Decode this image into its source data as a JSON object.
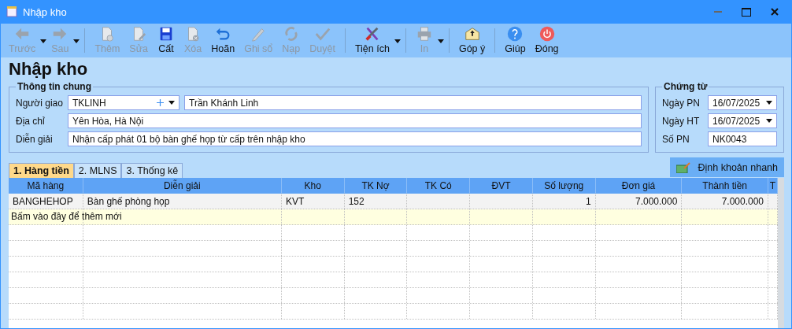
{
  "window": {
    "title": "Nhập kho"
  },
  "toolbar": {
    "groups": [
      [
        {
          "label": "Trước",
          "kind": "left",
          "enabled": false,
          "dropdown": true
        },
        {
          "label": "Sau",
          "kind": "right",
          "enabled": false,
          "dropdown": true
        }
      ],
      [
        {
          "label": "Thêm",
          "kind": "add",
          "enabled": false,
          "dropdown": false
        },
        {
          "label": "Sửa",
          "kind": "edit",
          "enabled": false,
          "dropdown": false
        },
        {
          "label": "Cất",
          "kind": "save",
          "enabled": true,
          "dropdown": false
        },
        {
          "label": "Xóa",
          "kind": "delete",
          "enabled": false,
          "dropdown": false
        },
        {
          "label": "Hoãn",
          "kind": "undo",
          "enabled": true,
          "dropdown": false
        },
        {
          "label": "Ghi sổ",
          "kind": "pencil",
          "enabled": false,
          "dropdown": false
        },
        {
          "label": "Nạp",
          "kind": "reload",
          "enabled": false,
          "dropdown": false
        },
        {
          "label": "Duyệt",
          "kind": "check",
          "enabled": false,
          "dropdown": false
        }
      ],
      [
        {
          "label": "Tiện ích",
          "kind": "tools",
          "enabled": true,
          "dropdown": true
        }
      ],
      [
        {
          "label": "In",
          "kind": "print",
          "enabled": false,
          "dropdown": true
        }
      ],
      [
        {
          "label": "Góp ý",
          "kind": "mail",
          "enabled": true,
          "dropdown": false
        }
      ],
      [
        {
          "label": "Giúp",
          "kind": "help",
          "enabled": true,
          "dropdown": false
        },
        {
          "label": "Đóng",
          "kind": "power",
          "enabled": true,
          "dropdown": false
        }
      ]
    ]
  },
  "heading": "Nhập kho",
  "general": {
    "title": "Thông tin chung",
    "fields": [
      {
        "label": "Người giao",
        "kind": "lookup",
        "value": "TKLINH",
        "name": "Trần Khánh Linh"
      },
      {
        "label": "Địa chỉ",
        "kind": "text",
        "value": "Yên Hòa, Hà Nội"
      },
      {
        "label": "Diễn giải",
        "kind": "text",
        "value": "Nhận cấp phát 01 bộ bàn ghế họp từ cấp trên nhập kho"
      }
    ]
  },
  "voucher": {
    "title": "Chứng từ",
    "fields": [
      {
        "label": "Ngày PN",
        "kind": "date",
        "value": "16/07/2025"
      },
      {
        "label": "Ngày HT",
        "kind": "date",
        "value": "16/07/2025"
      },
      {
        "label": "Số PN",
        "kind": "text",
        "value": "NK0043"
      }
    ]
  },
  "tabs": [
    {
      "label": "1. Hàng tiền",
      "selected": true
    },
    {
      "label": "2. MLNS",
      "selected": false
    },
    {
      "label": "3. Thống kê",
      "selected": false
    }
  ],
  "quick_entry_button": "Định khoản nhanh",
  "table": {
    "columns": [
      "Mã hàng",
      "Diễn giải",
      "Kho",
      "TK Nợ",
      "TK Có",
      "ĐVT",
      "Số lượng",
      "Đơn giá",
      "Thành tiền",
      "T"
    ],
    "rows": [
      {
        "kind": "item",
        "cells": [
          "BANGHEHOP",
          "Bàn ghế phòng họp",
          "KVT",
          "152",
          null,
          null,
          "1",
          "7.000.000",
          "7.000.000",
          null
        ]
      },
      {
        "kind": "new",
        "text": "Bấm vào đây để thêm mới"
      }
    ]
  }
}
